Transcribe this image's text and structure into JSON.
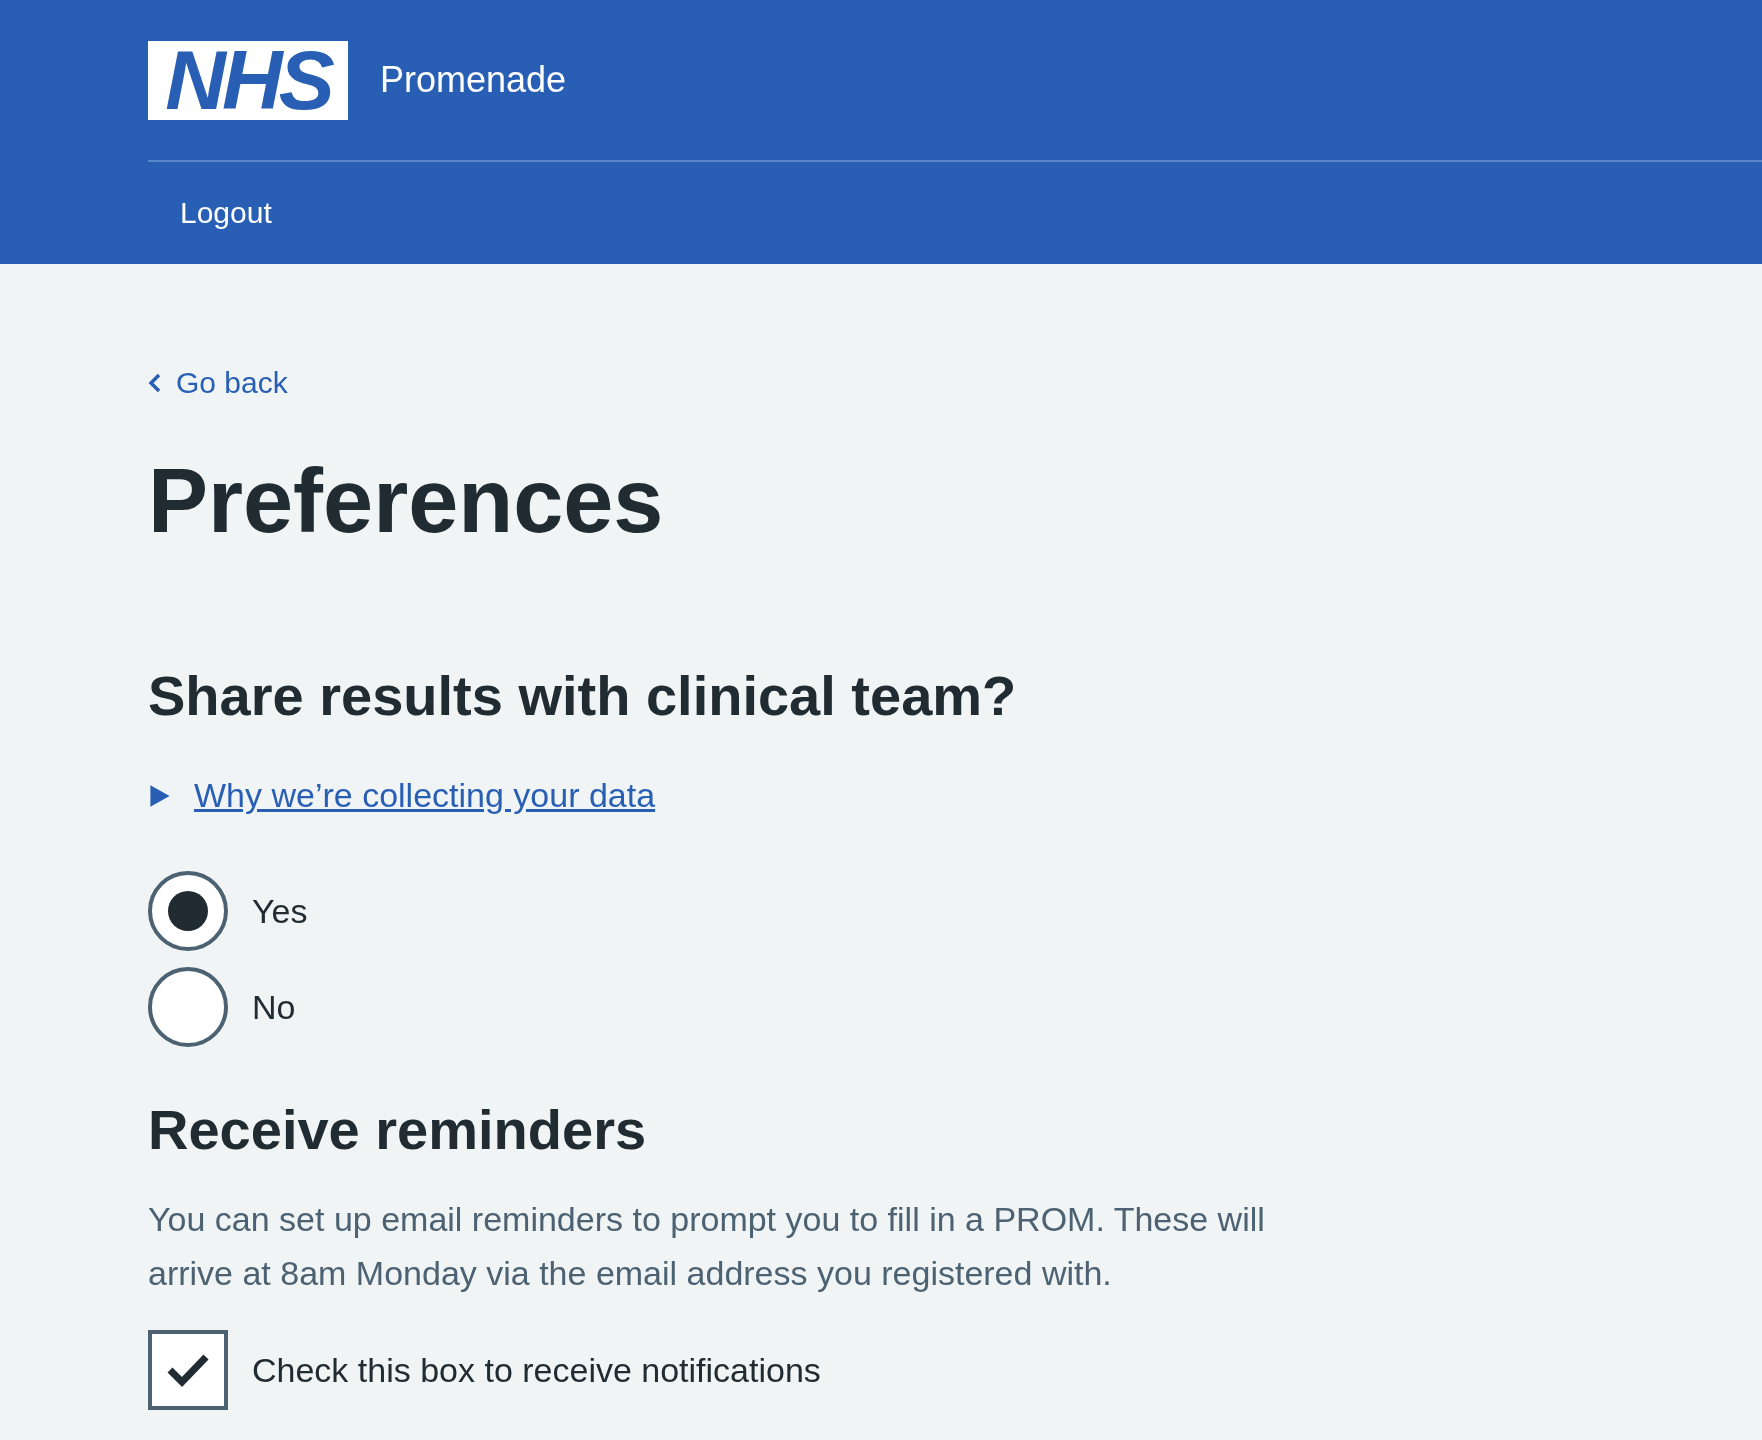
{
  "header": {
    "logo": "NHS",
    "service_name": "Promenade",
    "nav": [
      {
        "label": "Logout"
      }
    ]
  },
  "back_link": "Go back",
  "title": "Preferences",
  "sections": [
    {
      "kind": "radios",
      "heading": "Share results with clinical team?",
      "details": {
        "summary": "Why we’re collecting your data",
        "expanded": false
      },
      "options": [
        {
          "label": "Yes",
          "selected": true
        },
        {
          "label": "No",
          "selected": false
        }
      ]
    },
    {
      "kind": "checkboxes",
      "heading": "Receive reminders",
      "hint": "You can set up email reminders to prompt you to fill in a PROM. These will arrive at 8am Monday via the email address you registered with.",
      "options": [
        {
          "label": "Check this box to receive notifications",
          "checked": true
        }
      ]
    }
  ]
}
